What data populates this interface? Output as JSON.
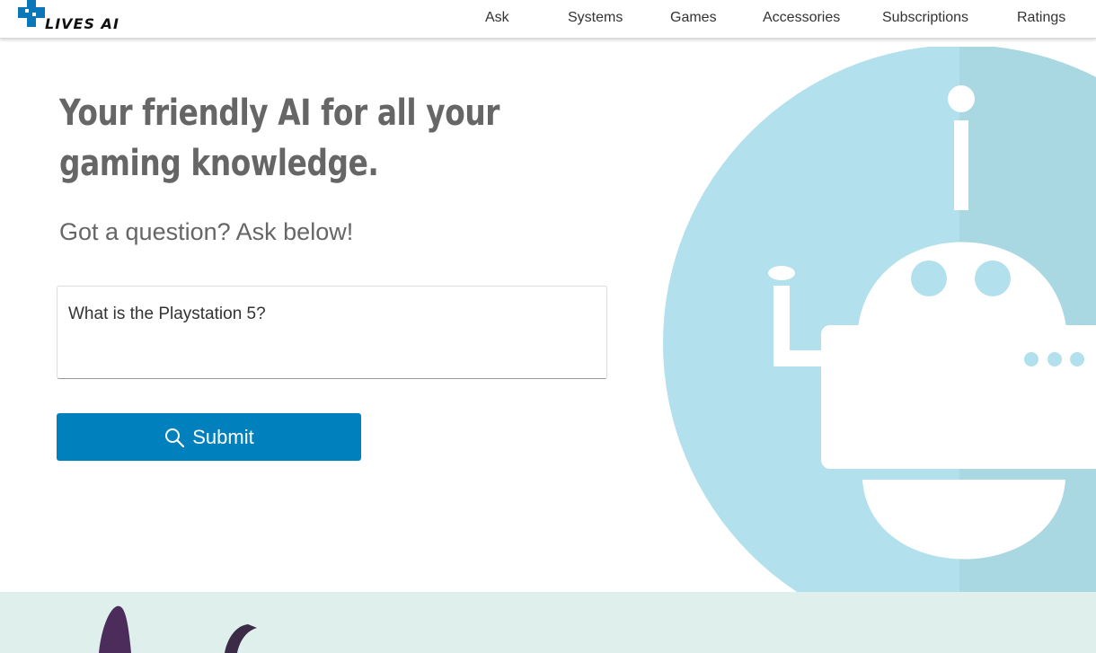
{
  "header": {
    "logo_text": "LIVES AI",
    "nav": [
      {
        "label": "Ask"
      },
      {
        "label": "Systems"
      },
      {
        "label": "Games"
      },
      {
        "label": "Accessories"
      },
      {
        "label": "Subscriptions"
      },
      {
        "label": "Ratings"
      }
    ]
  },
  "hero": {
    "title": "Your friendly AI for all your gaming knowledge.",
    "subtitle": "Got a question? Ask below!",
    "question_value": "What is the Playstation 5?",
    "submit_label": "Submit",
    "submit_icon": "search-icon"
  },
  "colors": {
    "accent": "#0081be",
    "robot_circle": "#b2e0ec",
    "bottom_band": "#dff0ec"
  }
}
